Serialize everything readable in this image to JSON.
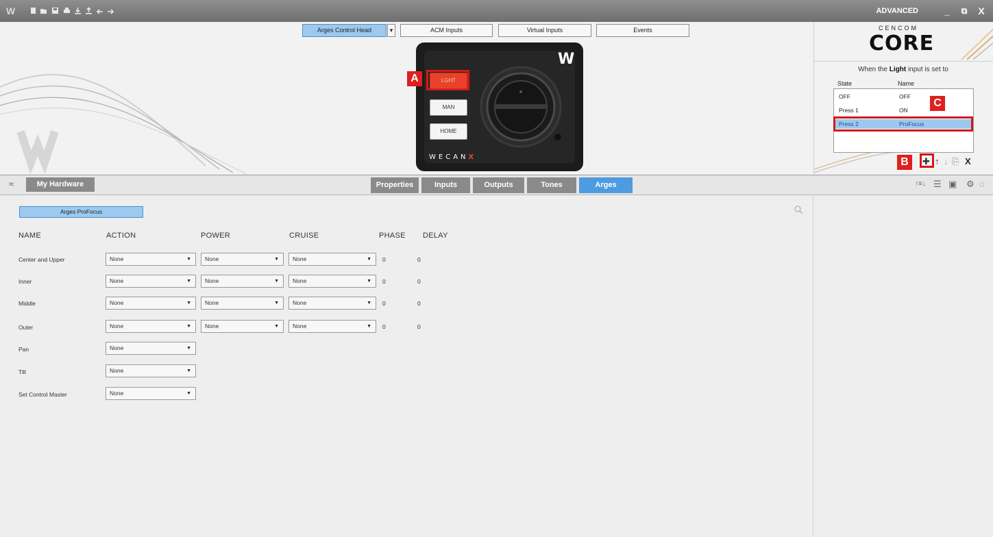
{
  "app": {
    "logo_glyph": "W",
    "mode": "ADVANCED",
    "window_controls": {
      "minimize": "_",
      "restore": "⧉",
      "close": "X"
    },
    "toolbar_icons": [
      "new-file-icon",
      "open-folder-icon",
      "save-icon",
      "print-icon",
      "download-icon",
      "upload-icon",
      "undo-icon",
      "redo-icon"
    ]
  },
  "top_tabs": [
    {
      "label": "Arges Control Head",
      "active": true
    },
    {
      "label": "ACM Inputs"
    },
    {
      "label": "Virtual Inputs"
    },
    {
      "label": "Events"
    }
  ],
  "device": {
    "buttons": [
      "LGHT",
      "MAN",
      "HOME"
    ],
    "logo": "W",
    "brand": "WECAN",
    "brand_suffix": "X"
  },
  "markers": {
    "a": "A",
    "b": "B",
    "c": "C"
  },
  "brand_panel": {
    "line1": "CENCOM",
    "line2": "CORE"
  },
  "state_panel": {
    "prefix": "When the",
    "input": "Light",
    "suffix": "input is set to",
    "col_state": "State",
    "col_name": "Name",
    "rows": [
      {
        "state": "OFF",
        "name": "OFF"
      },
      {
        "state": "Press 1",
        "name": "ON"
      },
      {
        "state": "Press 2",
        "name": "ProFocus",
        "selected": true
      }
    ],
    "tools": {
      "add": "✚",
      "up": "↑",
      "down": "↓",
      "copy": "⎘",
      "delete": "X"
    }
  },
  "hardware_button": "My Hardware",
  "panel_tabs": [
    {
      "label": "Properties"
    },
    {
      "label": "Inputs"
    },
    {
      "label": "Outputs"
    },
    {
      "label": "Tones"
    },
    {
      "label": "Arges",
      "active": true
    }
  ],
  "right_tools": [
    "sort-icon",
    "list-icon",
    "preview-icon",
    "gear-icon",
    "power-icon"
  ],
  "subtab": "Arges ProFocus",
  "table": {
    "columns": [
      "NAME",
      "ACTION",
      "POWER",
      "CRUISE",
      "PHASE",
      "DELAY"
    ],
    "rows": [
      {
        "name": "Center and Upper",
        "action": "None",
        "power": "None",
        "cruise": "None",
        "phase": "0",
        "delay": "0"
      },
      {
        "name": "Inner",
        "action": "None",
        "power": "None",
        "cruise": "None",
        "phase": "0",
        "delay": "0"
      },
      {
        "name": "Middle",
        "action": "None",
        "power": "None",
        "cruise": "None",
        "phase": "0",
        "delay": "0"
      },
      {
        "name": "Outer",
        "action": "None",
        "power": "None",
        "cruise": "None",
        "phase": "0",
        "delay": "0"
      },
      {
        "name": "Pan",
        "action": "None"
      },
      {
        "name": "Tilt",
        "action": "None"
      },
      {
        "name": "Set Control Master",
        "action": "None"
      }
    ]
  },
  "colors": {
    "accent": "#4d9be0",
    "selection": "#9cc9ef",
    "highlight": "#d61818",
    "light_button": "#e8432a"
  }
}
